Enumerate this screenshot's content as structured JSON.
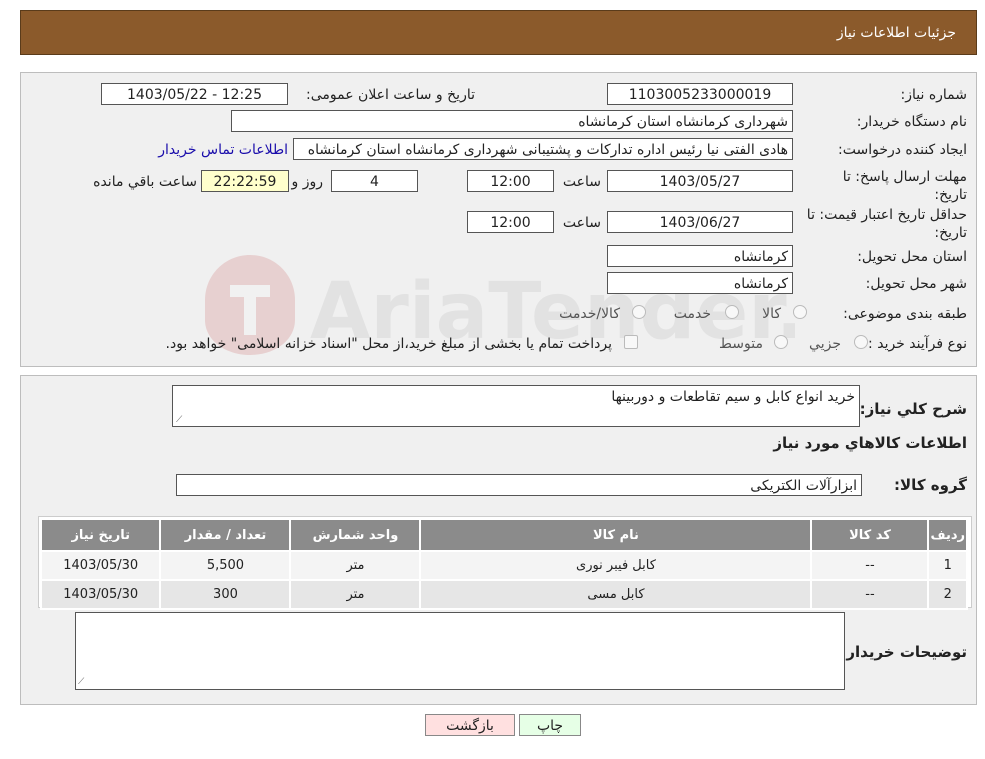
{
  "page_title": "جزئیات اطلاعات نیاز",
  "fields": {
    "need_number_label": "شماره نیاز:",
    "need_number": "1103005233000019",
    "announce_label": "تاریخ و ساعت اعلان عمومی:",
    "announce_value": "1403/05/22 - 12:25",
    "buyer_label": "نام دستگاه خریدار:",
    "buyer": "شهرداری کرمانشاه استان کرمانشاه",
    "creator_label": "ایجاد کننده درخواست:",
    "creator": "هادی الفتی نیا رئیس اداره تدارکات و پشتیبانی شهرداری کرمانشاه استان کرمانشاه",
    "contact_link": "اطلاعات تماس خریدار",
    "reply_deadline_label": "مهلت ارسال پاسخ: تا تاریخ:",
    "reply_date": "1403/05/27",
    "time_label": "ساعت",
    "reply_time": "12:00",
    "days": "4",
    "days_label": "روز و",
    "remaining": "22:22:59",
    "remaining_label": "ساعت باقي مانده",
    "validity_label": "حداقل تاریخ اعتبار قیمت: تا تاریخ:",
    "validity_date": "1403/06/27",
    "validity_time": "12:00",
    "province_label": "استان محل تحویل:",
    "province": "کرمانشاه",
    "city_label": "شهر محل تحویل:",
    "city": "کرمانشاه",
    "category_label": "طبقه بندی موضوعی:",
    "category_options": [
      "کالا",
      "خدمت",
      "کالا/خدمت"
    ],
    "process_label": "نوع فرآیند خرید :",
    "process_options": [
      "جزيي",
      "متوسط"
    ],
    "payment_note": "پرداخت تمام یا بخشی از مبلغ خرید،از محل \"اسناد خزانه اسلامی\" خواهد بود."
  },
  "details": {
    "description_label": "شرح کلي نياز:",
    "description": "خرید انواع کابل و سیم تقاطعات و دوربینها",
    "goods_info_title": "اطلاعات کالاهاي مورد نياز",
    "goods_group_label": "گروه کالا:",
    "goods_group": "ابزارآلات الکتریکی",
    "table_headers": [
      "رديف",
      "کد کالا",
      "نام کالا",
      "واحد شمارش",
      "تعداد / مقدار",
      "تاریخ نیاز"
    ],
    "rows": [
      [
        "1",
        "--",
        "کابل فیبر نوری",
        "متر",
        "5,500",
        "1403/05/30"
      ],
      [
        "2",
        "--",
        "کابل مسی",
        "متر",
        "300",
        "1403/05/30"
      ]
    ],
    "buyer_notes_label": "توضیحات خریدار:"
  },
  "buttons": {
    "print": "چاپ",
    "back": "بازگشت"
  },
  "watermark": "AriaTender.neT",
  "colors": {
    "header_bg": "#8b5a2b",
    "table_header_bg": "#8b8b8b",
    "remaining_bg": "#ffffcc",
    "link": "#1a0dab"
  }
}
